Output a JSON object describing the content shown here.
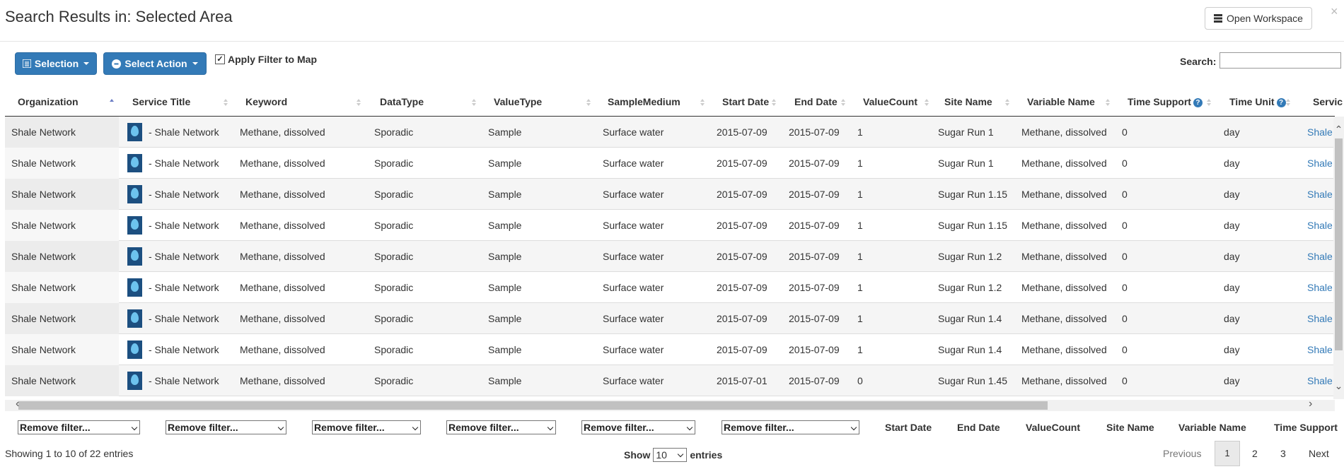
{
  "header": {
    "title": "Search Results in: Selected Area",
    "open_workspace_label": "Open Workspace",
    "close_glyph": "×"
  },
  "toolbar": {
    "selection_label": "Selection",
    "select_action_label": "Select Action",
    "apply_filter_label": "Apply Filter to Map",
    "apply_filter_checked": true,
    "search_label": "Search:",
    "search_value": ""
  },
  "table": {
    "columns": [
      "Organization",
      "Service Title",
      "Keyword",
      "DataType",
      "ValueType",
      "SampleMedium",
      "Start Date",
      "End Date",
      "ValueCount",
      "Site Name",
      "Variable Name",
      "Time Support",
      "Time Unit",
      "Servic"
    ],
    "help_glyph": "?",
    "sorted_column": "Organization",
    "rows": [
      {
        "organization": "Shale Network",
        "service_title": "- Shale Network",
        "keyword": "Methane, dissolved",
        "datatype": "Sporadic",
        "valuetype": "Sample",
        "samplemedium": "Surface water",
        "start_date": "2015-07-09",
        "end_date": "2015-07-09",
        "valuecount": "1",
        "site_name": "Sugar Run 1",
        "variable_name": "Methane, dissolved",
        "time_support": "0",
        "time_unit": "day",
        "service": "Shale"
      },
      {
        "organization": "Shale Network",
        "service_title": "- Shale Network",
        "keyword": "Methane, dissolved",
        "datatype": "Sporadic",
        "valuetype": "Sample",
        "samplemedium": "Surface water",
        "start_date": "2015-07-09",
        "end_date": "2015-07-09",
        "valuecount": "1",
        "site_name": "Sugar Run 1",
        "variable_name": "Methane, dissolved",
        "time_support": "0",
        "time_unit": "day",
        "service": "Shale"
      },
      {
        "organization": "Shale Network",
        "service_title": "- Shale Network",
        "keyword": "Methane, dissolved",
        "datatype": "Sporadic",
        "valuetype": "Sample",
        "samplemedium": "Surface water",
        "start_date": "2015-07-09",
        "end_date": "2015-07-09",
        "valuecount": "1",
        "site_name": "Sugar Run 1.15",
        "variable_name": "Methane, dissolved",
        "time_support": "0",
        "time_unit": "day",
        "service": "Shale"
      },
      {
        "organization": "Shale Network",
        "service_title": "- Shale Network",
        "keyword": "Methane, dissolved",
        "datatype": "Sporadic",
        "valuetype": "Sample",
        "samplemedium": "Surface water",
        "start_date": "2015-07-09",
        "end_date": "2015-07-09",
        "valuecount": "1",
        "site_name": "Sugar Run 1.15",
        "variable_name": "Methane, dissolved",
        "time_support": "0",
        "time_unit": "day",
        "service": "Shale"
      },
      {
        "organization": "Shale Network",
        "service_title": "- Shale Network",
        "keyword": "Methane, dissolved",
        "datatype": "Sporadic",
        "valuetype": "Sample",
        "samplemedium": "Surface water",
        "start_date": "2015-07-09",
        "end_date": "2015-07-09",
        "valuecount": "1",
        "site_name": "Sugar Run 1.2",
        "variable_name": "Methane, dissolved",
        "time_support": "0",
        "time_unit": "day",
        "service": "Shale"
      },
      {
        "organization": "Shale Network",
        "service_title": "- Shale Network",
        "keyword": "Methane, dissolved",
        "datatype": "Sporadic",
        "valuetype": "Sample",
        "samplemedium": "Surface water",
        "start_date": "2015-07-09",
        "end_date": "2015-07-09",
        "valuecount": "1",
        "site_name": "Sugar Run 1.2",
        "variable_name": "Methane, dissolved",
        "time_support": "0",
        "time_unit": "day",
        "service": "Shale"
      },
      {
        "organization": "Shale Network",
        "service_title": "- Shale Network",
        "keyword": "Methane, dissolved",
        "datatype": "Sporadic",
        "valuetype": "Sample",
        "samplemedium": "Surface water",
        "start_date": "2015-07-09",
        "end_date": "2015-07-09",
        "valuecount": "1",
        "site_name": "Sugar Run 1.4",
        "variable_name": "Methane, dissolved",
        "time_support": "0",
        "time_unit": "day",
        "service": "Shale"
      },
      {
        "organization": "Shale Network",
        "service_title": "- Shale Network",
        "keyword": "Methane, dissolved",
        "datatype": "Sporadic",
        "valuetype": "Sample",
        "samplemedium": "Surface water",
        "start_date": "2015-07-09",
        "end_date": "2015-07-09",
        "valuecount": "1",
        "site_name": "Sugar Run 1.4",
        "variable_name": "Methane, dissolved",
        "time_support": "0",
        "time_unit": "day",
        "service": "Shale"
      },
      {
        "organization": "Shale Network",
        "service_title": "- Shale Network",
        "keyword": "Methane, dissolved",
        "datatype": "Sporadic",
        "valuetype": "Sample",
        "samplemedium": "Surface water",
        "start_date": "2015-07-01",
        "end_date": "2015-07-09",
        "valuecount": "0",
        "site_name": "Sugar Run 1.45",
        "variable_name": "Methane, dissolved",
        "time_support": "0",
        "time_unit": "day",
        "service": "Shale"
      }
    ]
  },
  "filters": {
    "remove_filter_label": "Remove filter...",
    "footer_headers": [
      "Start Date",
      "End Date",
      "ValueCount",
      "Site Name",
      "Variable Name",
      "Time Support"
    ]
  },
  "footer": {
    "info": "Showing 1 to 10 of 22 entries",
    "show_label": "Show",
    "entries_value": "10",
    "entries_label": "entries",
    "pagination": {
      "previous": "Previous",
      "pages": [
        "1",
        "2",
        "3"
      ],
      "next": "Next"
    }
  },
  "icons": {
    "workspace": "server-stack-icon",
    "selection": "list-icon",
    "action": "circle-icon",
    "help": "question-circle-icon",
    "service_logo": "water-drop-logo-icon"
  },
  "colors": {
    "primary": "#337ab7",
    "link": "#337ab7"
  }
}
